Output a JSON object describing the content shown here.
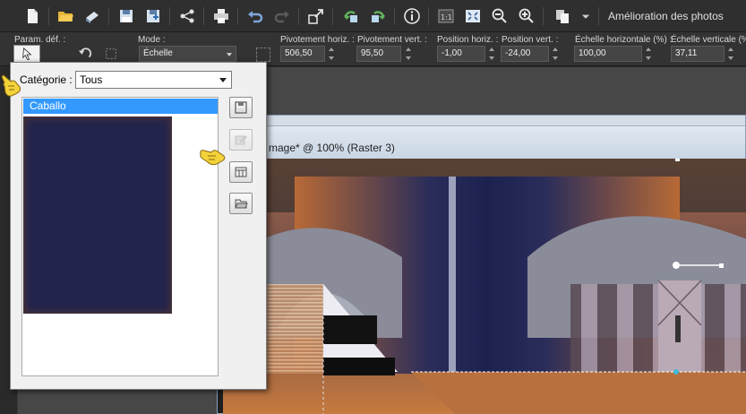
{
  "toolbar": {
    "photo_enhancement_label": "Amélioration des photos",
    "icons": [
      "new-document-icon",
      "open-folder-icon",
      "scan-icon",
      "save-icon",
      "save-as-icon",
      "share-icon",
      "print-icon",
      "undo-icon",
      "redo-icon",
      "resize-icon",
      "rotate-left-icon",
      "rotate-right-icon",
      "info-icon",
      "actual-size-icon",
      "fit-window-icon",
      "zoom-out-icon",
      "zoom-in-icon",
      "copy-icon"
    ]
  },
  "options_bar": {
    "presets_label": "Param. déf. :",
    "mode_label": "Mode :",
    "mode_value": "Échelle",
    "pivot_h_label": "Pivotement horiz. :",
    "pivot_h_value": "506,50",
    "pivot_v_label": "Pivotement vert. :",
    "pivot_v_value": "95,50",
    "pos_h_label": "Position horiz. :",
    "pos_h_value": "-1,00",
    "pos_v_label": "Position vert. :",
    "pos_v_value": "-24,00",
    "scale_h_label": "Échelle horizontale (%) :",
    "scale_h_value": "100,00",
    "scale_v_label": "Échelle verticale (%",
    "scale_v_value": "37,11"
  },
  "dialog": {
    "category_label": "Catégorie :",
    "category_value": "Tous",
    "preset_item": "Caballo"
  },
  "document": {
    "title": "mage* @ 100% (Raster 3)"
  },
  "colors": {
    "selection": "#3399ff",
    "thumbnail": "#23244d",
    "canvas_orange": "#c0682a",
    "canvas_navy": "#1c2150"
  }
}
